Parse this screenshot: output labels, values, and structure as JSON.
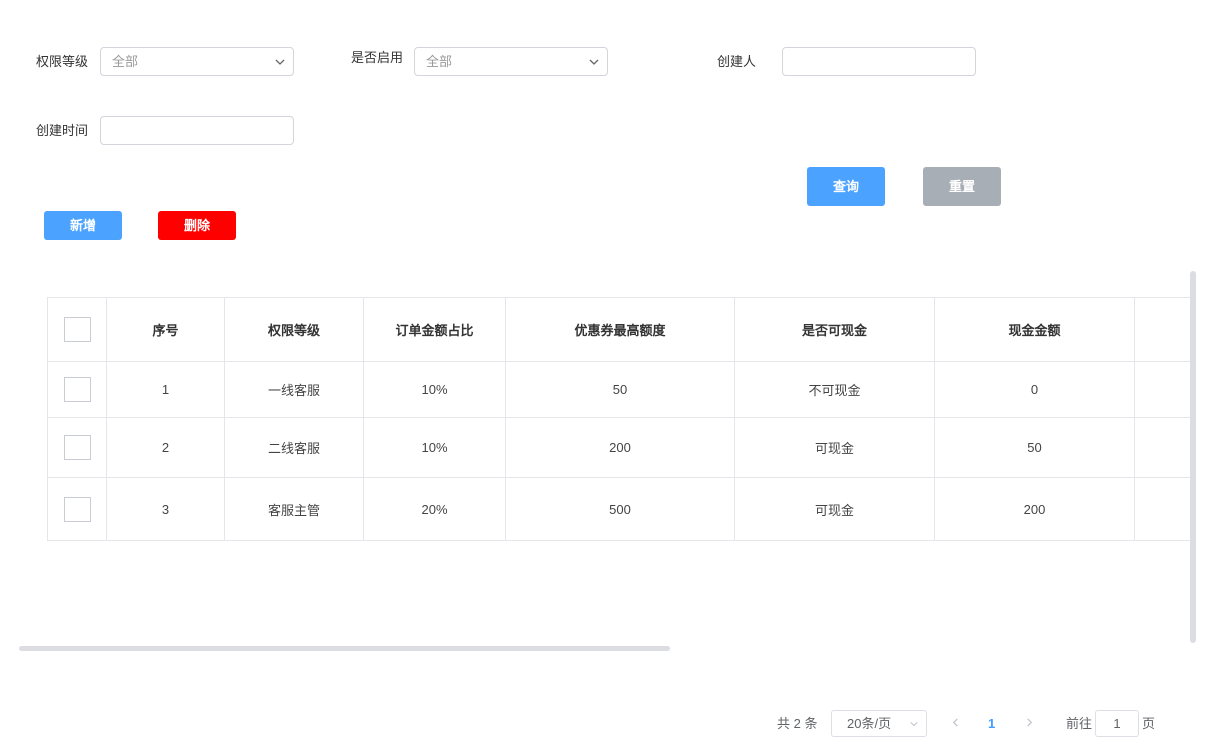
{
  "filters": {
    "level_label": "权限等级",
    "level_value": "全部",
    "enabled_label": "是否启用",
    "enabled_value": "全部",
    "creator_label": "创建人",
    "creator_value": "",
    "created_time_label": "创建时间",
    "created_time_value": ""
  },
  "actions": {
    "query_label": "查询",
    "reset_label": "重置",
    "add_label": "新增",
    "delete_label": "删除"
  },
  "table": {
    "headers": [
      "序号",
      "权限等级",
      "订单金额占比",
      "优惠券最高额度",
      "是否可现金",
      "现金金额"
    ],
    "rows": [
      [
        "1",
        "一线客服",
        "10%",
        "50",
        "不可现金",
        "0"
      ],
      [
        "2",
        "二线客服",
        "10%",
        "200",
        "可现金",
        "50"
      ],
      [
        "3",
        "客服主管",
        "20%",
        "500",
        "可现金",
        "200"
      ]
    ]
  },
  "pagination": {
    "total_text": "共 2 条",
    "page_size": "20条/页",
    "current_page": "1",
    "goto_label": "前往",
    "goto_value": "1",
    "page_suffix": "页"
  },
  "icons": {
    "chevron_down": "chevron-down-icon",
    "prev": "chevron-left-icon",
    "next": "chevron-right-icon"
  }
}
